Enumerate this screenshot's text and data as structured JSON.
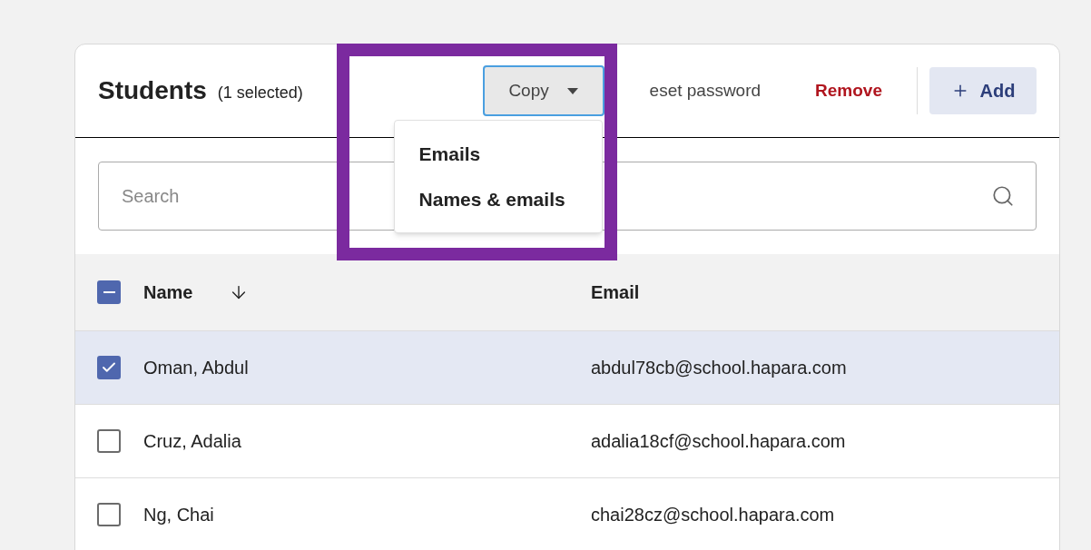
{
  "header": {
    "title": "Students",
    "selection_note": "(1 selected)"
  },
  "copy_button": {
    "label": "Copy",
    "expanded": true,
    "menu": [
      {
        "label": "Emails"
      },
      {
        "label": "Names & emails"
      }
    ]
  },
  "actions": [
    {
      "kind": "plain",
      "label": "eset password"
    },
    {
      "kind": "danger",
      "label": "Remove"
    },
    {
      "kind": "add",
      "label": "Add"
    }
  ],
  "search": {
    "placeholder": "Search"
  },
  "table": {
    "select_all": {
      "indeterminate": true
    },
    "columns": [
      {
        "label": "Name",
        "sorted": true
      },
      {
        "label": "Email",
        "sorted": false
      }
    ],
    "rows": [
      {
        "name": "Oman, Abdul",
        "email": "abdul78cb@school.hapara.com",
        "selected": true
      },
      {
        "name": "Cruz, Adalia",
        "email": "adalia18cf@school.hapara.com",
        "selected": false
      },
      {
        "name": "Ng, Chai",
        "email": "chai28cz@school.hapara.com",
        "selected": false
      }
    ]
  },
  "annotation": {
    "highlight": true
  }
}
